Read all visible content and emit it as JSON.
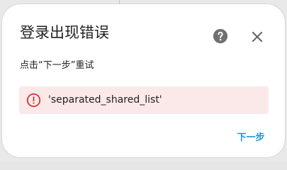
{
  "dialog": {
    "title": "登录出现错误",
    "message": "点击“下一步”重试",
    "help_icon": "help-circle-icon",
    "close_icon": "close-icon",
    "error": {
      "icon": "alert-circle-icon",
      "text": "'separated_shared_list'",
      "background_color": "#fbe9e9",
      "icon_color": "#d32f2f"
    },
    "next_button_label": "下一步",
    "accent_color": "#1a96d4"
  }
}
